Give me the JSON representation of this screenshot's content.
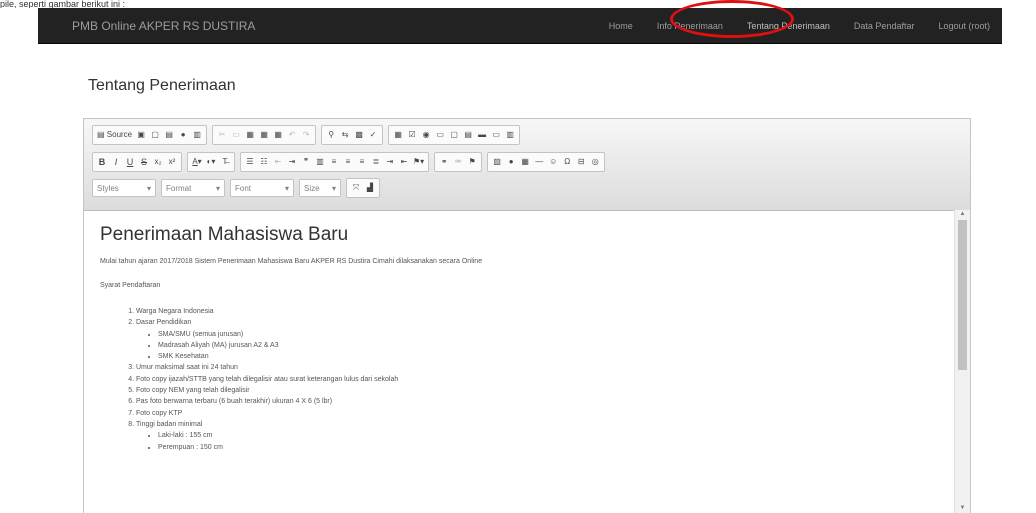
{
  "caption": "pile, seperti gambar berikut ini :",
  "navbar": {
    "brand": "PMB Online AKPER RS DUSTIRA",
    "items": [
      {
        "label": "Home"
      },
      {
        "label": "Info Penerimaan"
      },
      {
        "label": "Tentang Penerimaan"
      },
      {
        "label": "Data Pendaftar"
      },
      {
        "label": "Logout (root)"
      }
    ],
    "active_index": 2
  },
  "page_title": "Tentang Penerimaan",
  "toolbar": {
    "source_label": "Source",
    "bold": "B",
    "italic": "I",
    "underline": "U",
    "strike": "S",
    "subscript": "x₂",
    "superscript": "x²",
    "text_color": "A",
    "styles_label": "Styles",
    "format_label": "Format",
    "font_label": "Font",
    "size_label": "Size"
  },
  "content": {
    "heading": "Penerimaan Mahasiswa Baru",
    "intro": "Mulai tahun ajaran 2017/2018 Sistem Penerimaan Mahasiswa Baru AKPER RS Dustira Cimahi dilaksanakan secara Online",
    "requirements_title": "Syarat Pendaftaran",
    "req1": "Warga Negara Indonesia",
    "req2": "Dasar Pendidikan",
    "req2_sub1": "SMA/SMU (semua jurusan)",
    "req2_sub2": "Madrasah Aliyah (MA) jurusan A2 & A3",
    "req2_sub3": "SMK Kesehatan",
    "req3": "Umur maksimal saat ini 24 tahun",
    "req4": "Foto copy ijazah/STTB yang telah dilegalisir atau surat keterangan lulus dari sekolah",
    "req5": "Foto copy NEM yang telah dilegalisir",
    "req6": "Pas foto berwarna terbaru (6 buah terakhir) ukuran 4 X 6 (5 lbr)",
    "req7": "Foto copy KTP",
    "req8": "Tinggi badan minimal",
    "req8_sub1": "Laki-laki : 155 cm",
    "req8_sub2": "Perempuan : 150 cm"
  },
  "colors": {
    "navbar_bg": "#222222",
    "navbar_text": "#9d9d9d",
    "highlight_ring": "#e01010"
  }
}
